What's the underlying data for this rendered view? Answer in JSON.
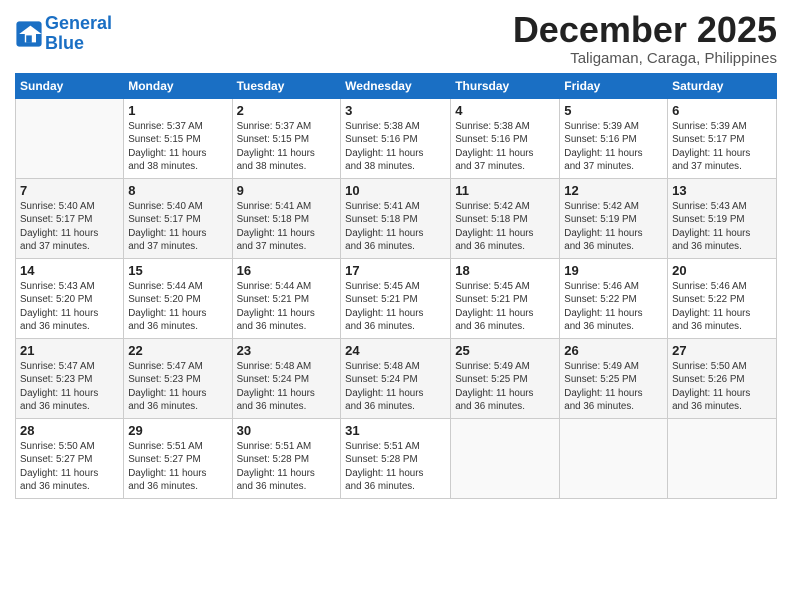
{
  "logo": {
    "line1": "General",
    "line2": "Blue"
  },
  "title": "December 2025",
  "location": "Taligaman, Caraga, Philippines",
  "days_header": [
    "Sunday",
    "Monday",
    "Tuesday",
    "Wednesday",
    "Thursday",
    "Friday",
    "Saturday"
  ],
  "weeks": [
    [
      {
        "day": "",
        "info": ""
      },
      {
        "day": "1",
        "info": "Sunrise: 5:37 AM\nSunset: 5:15 PM\nDaylight: 11 hours\nand 38 minutes."
      },
      {
        "day": "2",
        "info": "Sunrise: 5:37 AM\nSunset: 5:15 PM\nDaylight: 11 hours\nand 38 minutes."
      },
      {
        "day": "3",
        "info": "Sunrise: 5:38 AM\nSunset: 5:16 PM\nDaylight: 11 hours\nand 38 minutes."
      },
      {
        "day": "4",
        "info": "Sunrise: 5:38 AM\nSunset: 5:16 PM\nDaylight: 11 hours\nand 37 minutes."
      },
      {
        "day": "5",
        "info": "Sunrise: 5:39 AM\nSunset: 5:16 PM\nDaylight: 11 hours\nand 37 minutes."
      },
      {
        "day": "6",
        "info": "Sunrise: 5:39 AM\nSunset: 5:17 PM\nDaylight: 11 hours\nand 37 minutes."
      }
    ],
    [
      {
        "day": "7",
        "info": "Sunrise: 5:40 AM\nSunset: 5:17 PM\nDaylight: 11 hours\nand 37 minutes."
      },
      {
        "day": "8",
        "info": "Sunrise: 5:40 AM\nSunset: 5:17 PM\nDaylight: 11 hours\nand 37 minutes."
      },
      {
        "day": "9",
        "info": "Sunrise: 5:41 AM\nSunset: 5:18 PM\nDaylight: 11 hours\nand 37 minutes."
      },
      {
        "day": "10",
        "info": "Sunrise: 5:41 AM\nSunset: 5:18 PM\nDaylight: 11 hours\nand 36 minutes."
      },
      {
        "day": "11",
        "info": "Sunrise: 5:42 AM\nSunset: 5:18 PM\nDaylight: 11 hours\nand 36 minutes."
      },
      {
        "day": "12",
        "info": "Sunrise: 5:42 AM\nSunset: 5:19 PM\nDaylight: 11 hours\nand 36 minutes."
      },
      {
        "day": "13",
        "info": "Sunrise: 5:43 AM\nSunset: 5:19 PM\nDaylight: 11 hours\nand 36 minutes."
      }
    ],
    [
      {
        "day": "14",
        "info": "Sunrise: 5:43 AM\nSunset: 5:20 PM\nDaylight: 11 hours\nand 36 minutes."
      },
      {
        "day": "15",
        "info": "Sunrise: 5:44 AM\nSunset: 5:20 PM\nDaylight: 11 hours\nand 36 minutes."
      },
      {
        "day": "16",
        "info": "Sunrise: 5:44 AM\nSunset: 5:21 PM\nDaylight: 11 hours\nand 36 minutes."
      },
      {
        "day": "17",
        "info": "Sunrise: 5:45 AM\nSunset: 5:21 PM\nDaylight: 11 hours\nand 36 minutes."
      },
      {
        "day": "18",
        "info": "Sunrise: 5:45 AM\nSunset: 5:21 PM\nDaylight: 11 hours\nand 36 minutes."
      },
      {
        "day": "19",
        "info": "Sunrise: 5:46 AM\nSunset: 5:22 PM\nDaylight: 11 hours\nand 36 minutes."
      },
      {
        "day": "20",
        "info": "Sunrise: 5:46 AM\nSunset: 5:22 PM\nDaylight: 11 hours\nand 36 minutes."
      }
    ],
    [
      {
        "day": "21",
        "info": "Sunrise: 5:47 AM\nSunset: 5:23 PM\nDaylight: 11 hours\nand 36 minutes."
      },
      {
        "day": "22",
        "info": "Sunrise: 5:47 AM\nSunset: 5:23 PM\nDaylight: 11 hours\nand 36 minutes."
      },
      {
        "day": "23",
        "info": "Sunrise: 5:48 AM\nSunset: 5:24 PM\nDaylight: 11 hours\nand 36 minutes."
      },
      {
        "day": "24",
        "info": "Sunrise: 5:48 AM\nSunset: 5:24 PM\nDaylight: 11 hours\nand 36 minutes."
      },
      {
        "day": "25",
        "info": "Sunrise: 5:49 AM\nSunset: 5:25 PM\nDaylight: 11 hours\nand 36 minutes."
      },
      {
        "day": "26",
        "info": "Sunrise: 5:49 AM\nSunset: 5:25 PM\nDaylight: 11 hours\nand 36 minutes."
      },
      {
        "day": "27",
        "info": "Sunrise: 5:50 AM\nSunset: 5:26 PM\nDaylight: 11 hours\nand 36 minutes."
      }
    ],
    [
      {
        "day": "28",
        "info": "Sunrise: 5:50 AM\nSunset: 5:27 PM\nDaylight: 11 hours\nand 36 minutes."
      },
      {
        "day": "29",
        "info": "Sunrise: 5:51 AM\nSunset: 5:27 PM\nDaylight: 11 hours\nand 36 minutes."
      },
      {
        "day": "30",
        "info": "Sunrise: 5:51 AM\nSunset: 5:28 PM\nDaylight: 11 hours\nand 36 minutes."
      },
      {
        "day": "31",
        "info": "Sunrise: 5:51 AM\nSunset: 5:28 PM\nDaylight: 11 hours\nand 36 minutes."
      },
      {
        "day": "",
        "info": ""
      },
      {
        "day": "",
        "info": ""
      },
      {
        "day": "",
        "info": ""
      }
    ]
  ]
}
